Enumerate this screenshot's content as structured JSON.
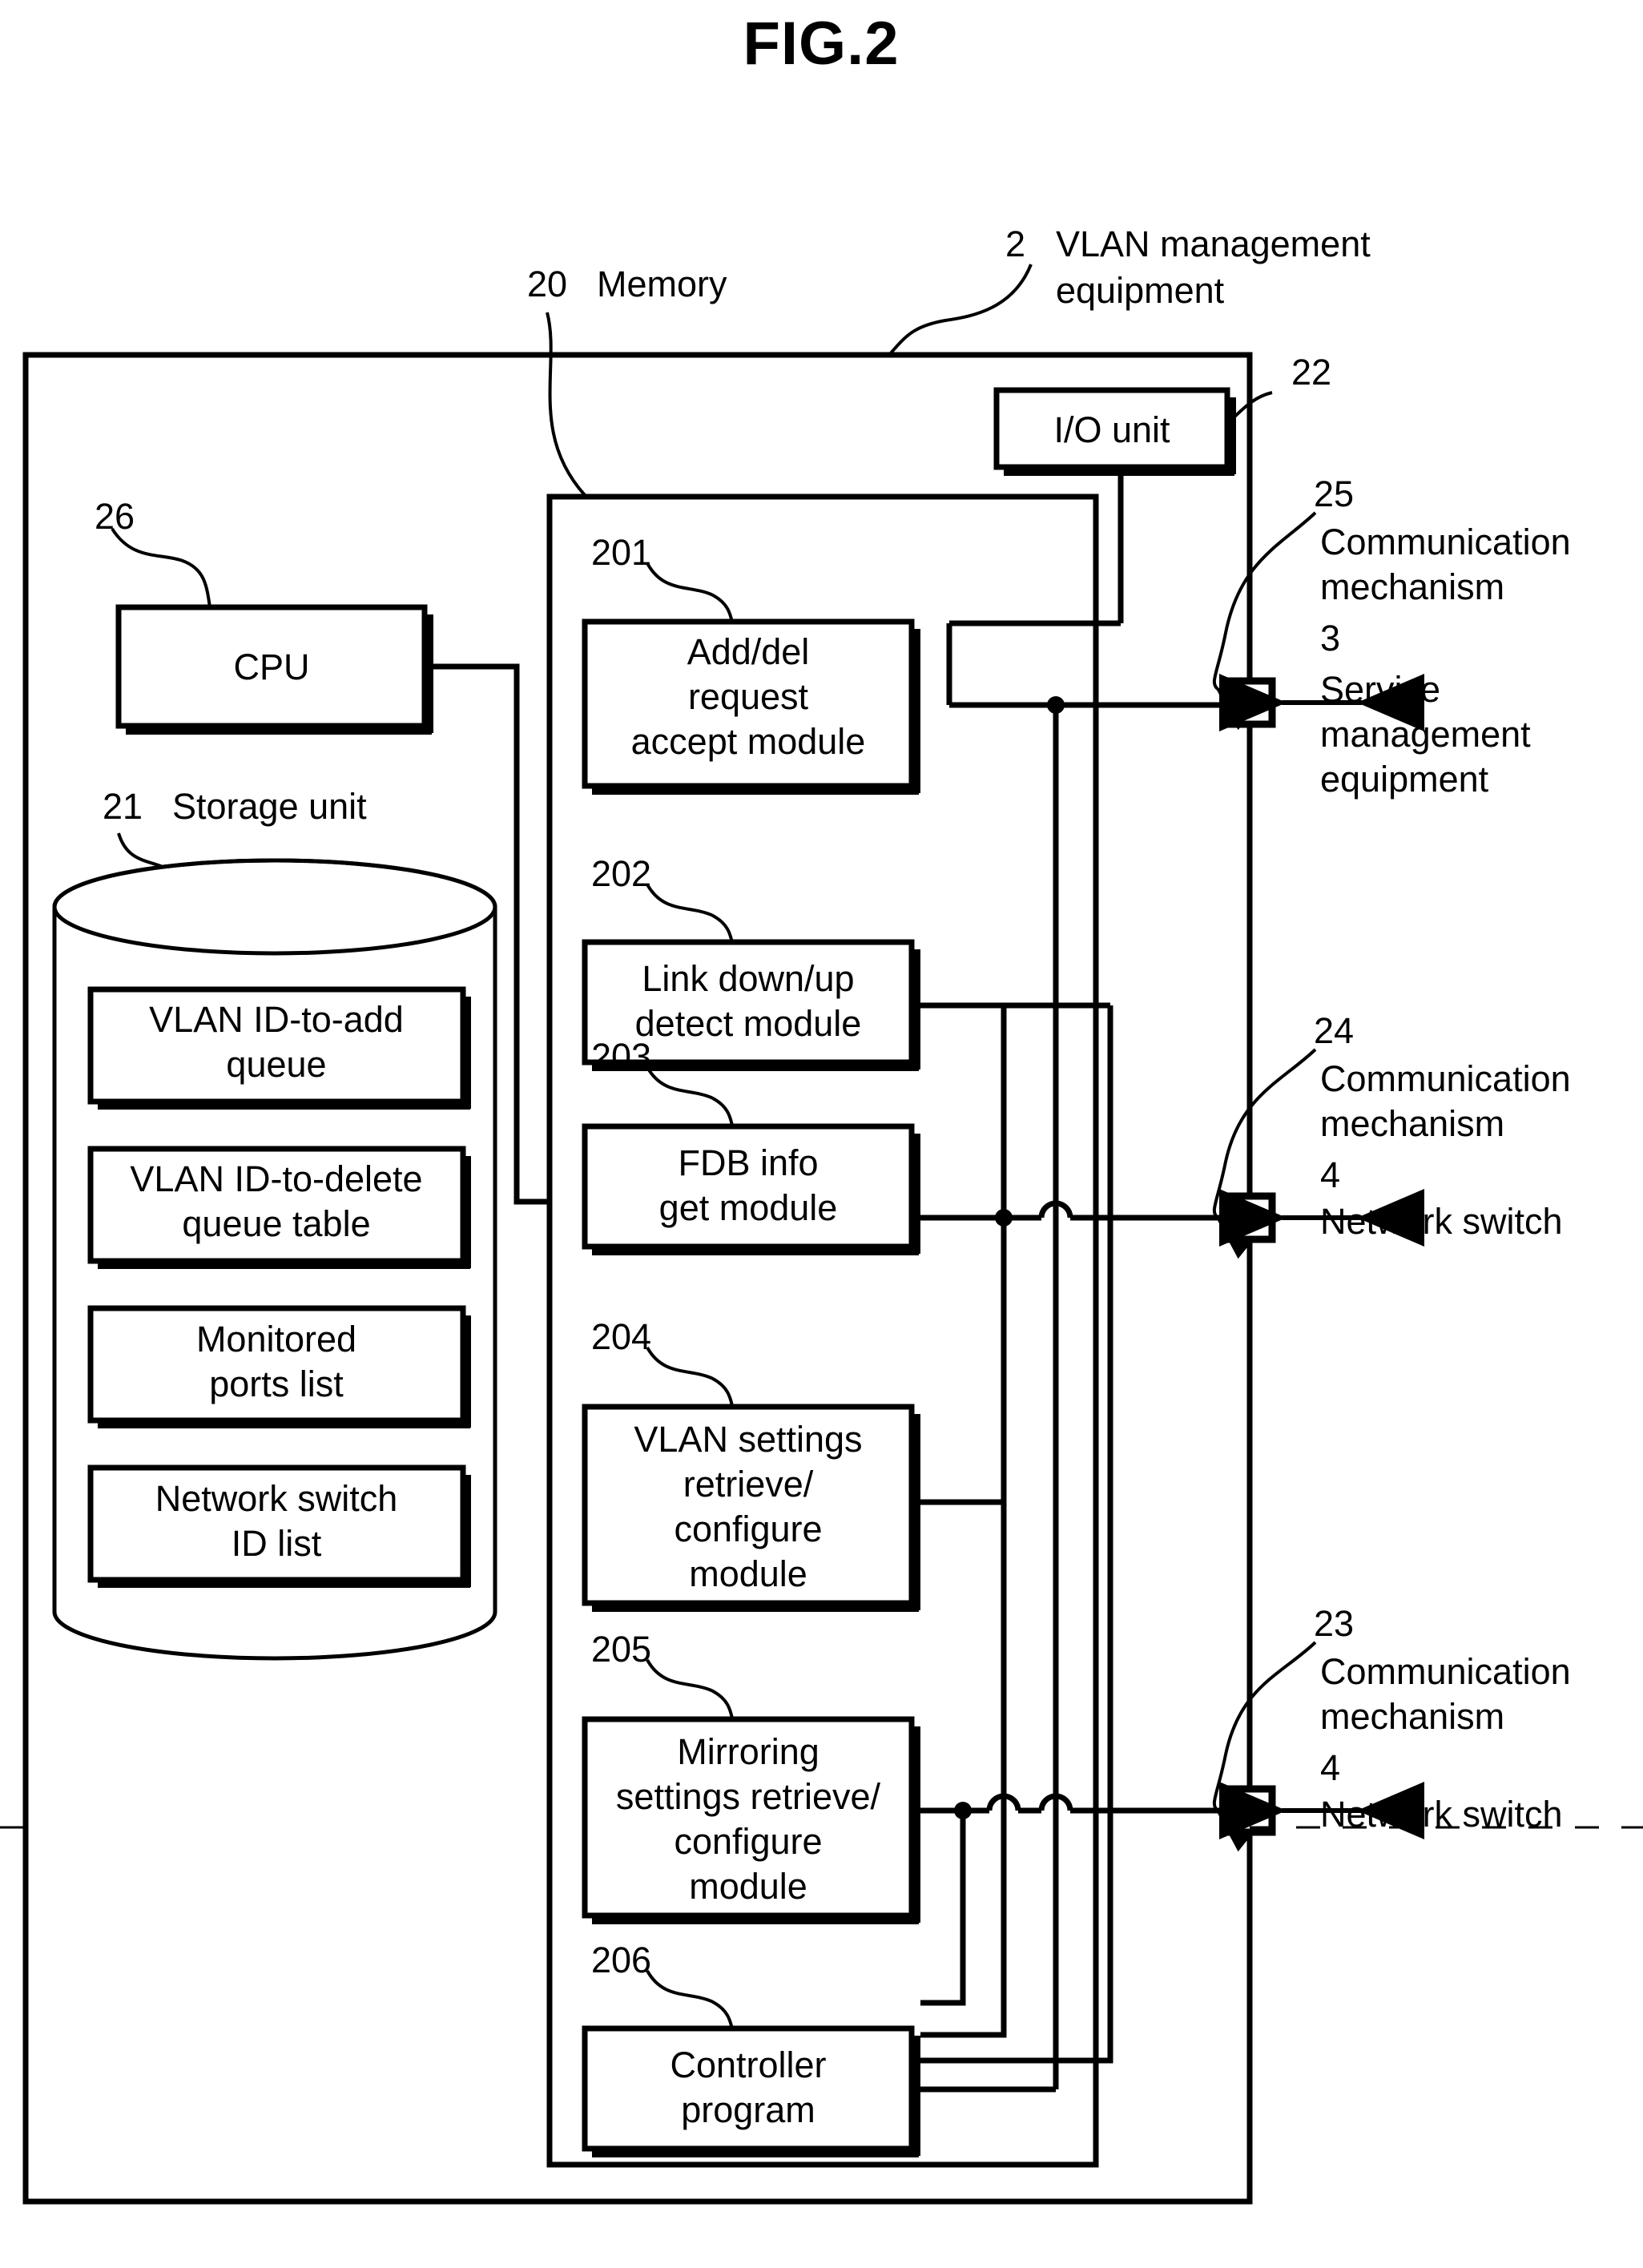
{
  "figure": {
    "title": "FIG.2",
    "type": "patent-block-diagram"
  },
  "callouts": {
    "memory": {
      "ref": "20",
      "label": "Memory"
    },
    "equipment": {
      "ref": "2",
      "label_line1": "VLAN management",
      "label_line2": "equipment"
    },
    "io_unit": {
      "ref": "22"
    },
    "cpu": {
      "ref": "26"
    },
    "storage_unit": {
      "ref": "21",
      "label": "Storage unit"
    },
    "comm_25": {
      "ref": "25",
      "line1": "Communication",
      "line2": "mechanism"
    },
    "comm_24": {
      "ref": "24",
      "line1": "Communication",
      "line2": "mechanism"
    },
    "comm_23": {
      "ref": "23",
      "line1": "Communication",
      "line2": "mechanism"
    },
    "service_mgmt": {
      "ref": "3",
      "line1": "Service",
      "line2": "management",
      "line3": "equipment"
    },
    "net_switch_upper": {
      "ref": "4",
      "label": "Network switch"
    },
    "net_switch_lower": {
      "ref": "4",
      "label": "Network switch"
    }
  },
  "boxes": {
    "io_unit": {
      "label": "I/O unit"
    },
    "cpu": {
      "label": "CPU"
    }
  },
  "storage_items": [
    {
      "line1": "VLAN ID-to-add",
      "line2": "queue"
    },
    {
      "line1": "VLAN ID-to-delete",
      "line2": "queue table"
    },
    {
      "line1": "Monitored",
      "line2": "ports list"
    },
    {
      "line1": "Network switch",
      "line2": "ID list"
    }
  ],
  "memory_modules": [
    {
      "ref": "201",
      "lines": [
        "Add/del",
        "request",
        "accept module"
      ]
    },
    {
      "ref": "202",
      "lines": [
        "Link down/up",
        "detect module"
      ]
    },
    {
      "ref": "203",
      "lines": [
        "FDB info",
        "get module"
      ]
    },
    {
      "ref": "204",
      "lines": [
        "VLAN settings",
        "retrieve/",
        "configure",
        "module"
      ]
    },
    {
      "ref": "205",
      "lines": [
        "Mirroring",
        "settings retrieve/",
        "configure",
        "module"
      ]
    },
    {
      "ref": "206",
      "lines": [
        "Controller",
        "program"
      ]
    }
  ],
  "colors": {
    "ink": "#000000",
    "paper": "#ffffff"
  }
}
